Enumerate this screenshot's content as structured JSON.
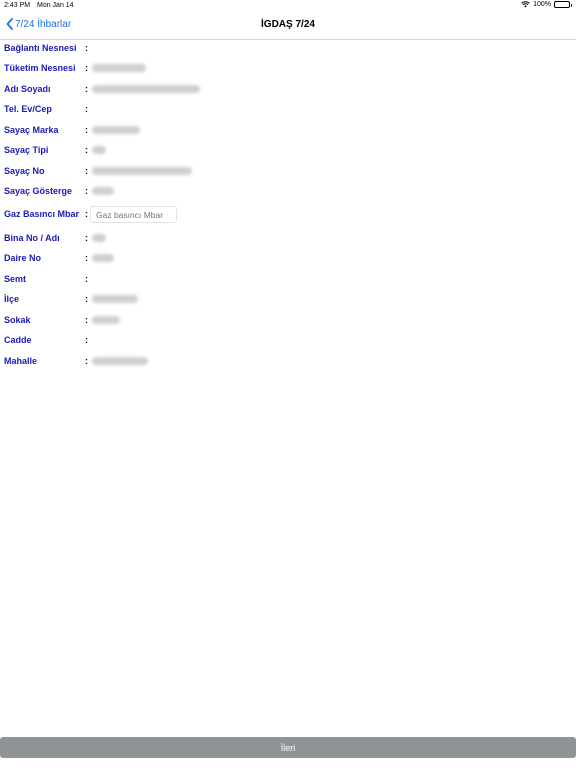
{
  "status_bar": {
    "time": "2:43 PM",
    "date": "Mon Jan 14",
    "battery": "100%"
  },
  "nav": {
    "back_label": "7/24 İhbarlar",
    "title": "İGDAŞ 7/24"
  },
  "fields": [
    {
      "label": "Bağlantı Nesnesi",
      "colon": ":"
    },
    {
      "label": "Tüketim Nesnesi",
      "colon": ":"
    },
    {
      "label": "Adı Soyadı",
      "colon": ":"
    },
    {
      "label": "Tel. Ev/Cep",
      "colon": ":"
    },
    {
      "label": "Sayaç Marka",
      "colon": ":"
    },
    {
      "label": "Sayaç Tipi",
      "colon": ":"
    },
    {
      "label": "Sayaç No",
      "colon": ":"
    },
    {
      "label": "Sayaç Gösterge",
      "colon": ":"
    },
    {
      "label": "Gaz Basıncı Mbar",
      "colon": ":",
      "placeholder": "Gaz basıncı Mbar"
    },
    {
      "label": "Bina No / Adı",
      "colon": ":"
    },
    {
      "label": "Daire No",
      "colon": ":"
    },
    {
      "label": "Semt",
      "colon": ":"
    },
    {
      "label": "İlçe",
      "colon": ":"
    },
    {
      "label": "Sokak",
      "colon": ":"
    },
    {
      "label": "Cadde",
      "colon": ":"
    },
    {
      "label": "Mahalle",
      "colon": ":"
    }
  ],
  "footer": {
    "next_label": "İleri"
  }
}
